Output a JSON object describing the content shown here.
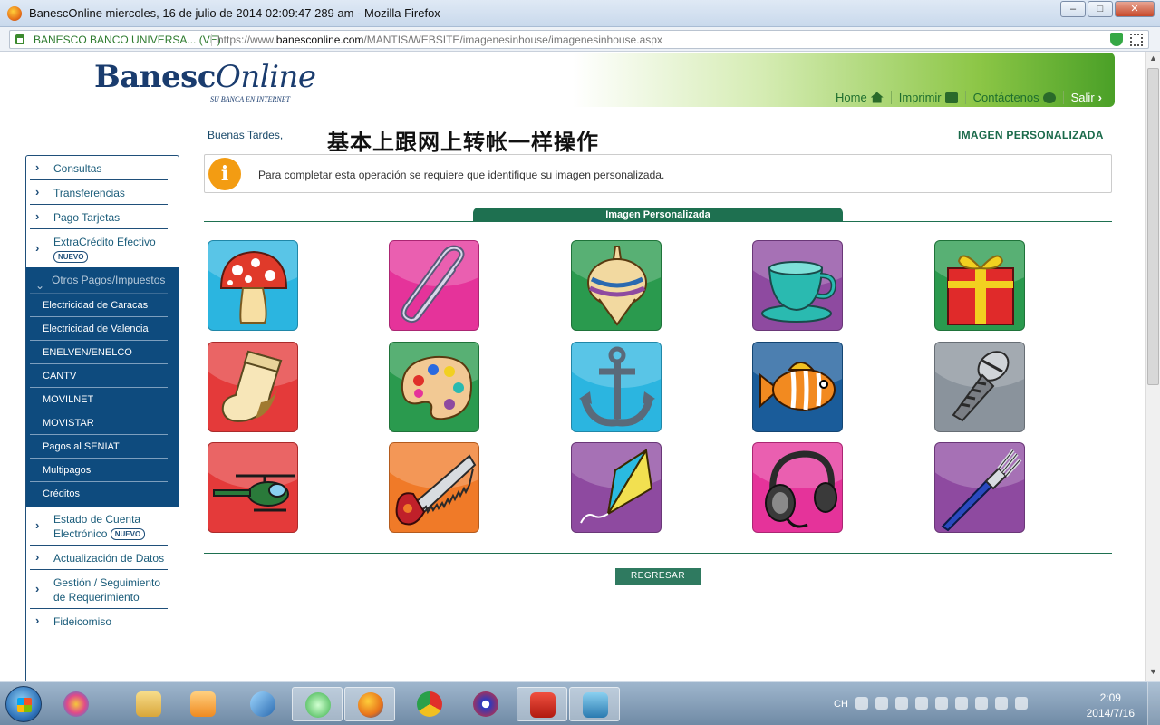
{
  "window": {
    "title": "BanescOnline miercoles, 16 de julio de 2014 02:09:47 289 am - Mozilla Firefox",
    "minimize": "–",
    "maximize": "□",
    "close": "✕"
  },
  "addressbar": {
    "site_identity": "BANESCO BANCO UNIVERSA...  (VE)",
    "url_prefix": "https://www.",
    "url_domain": "banesconline.com",
    "url_path": "/MANTIS/WEBSITE/imagenesinhouse/imagenesinhouse.aspx"
  },
  "header": {
    "logo_main": "Banesc",
    "logo_italic": "Online",
    "logo_tagline": "SU BANCA EN INTERNET",
    "nav": {
      "home": "Home",
      "print": "Imprimir",
      "contact": "Contáctenos",
      "exit": "Salir"
    }
  },
  "sidebar": {
    "items_top": [
      {
        "label": "Consultas"
      },
      {
        "label": "Transferencias"
      },
      {
        "label": "Pago Tarjetas"
      },
      {
        "label": "ExtraCrédito Efectivo",
        "badge": "NUEVO"
      }
    ],
    "group": {
      "label": "Otros Pagos/Impuestos",
      "items": [
        "Electricidad de Caracas",
        "Electricidad de Valencia",
        "ENELVEN/ENELCO",
        "CANTV",
        "MOVILNET",
        "MOVISTAR",
        "Pagos al SENIAT",
        "Multipagos",
        "Créditos"
      ]
    },
    "items_bottom": [
      {
        "label": "Estado de Cuenta Electrónico",
        "badge": "NUEVO"
      },
      {
        "label": "Actualización de Datos"
      },
      {
        "label": "Gestión / Seguimiento de Requerimiento"
      },
      {
        "label": "Fideicomiso"
      }
    ]
  },
  "main": {
    "greeting": "Buenas Tardes,",
    "overlay_note": "基本上跟网上转帐一样操作",
    "heading": "IMAGEN PERSONALIZADA",
    "info_icon": "i",
    "info_text": "Para completar esta operación se requiere que identifique su imagen personalizada.",
    "section_title": "Imagen Personalizada",
    "back_button": "REGRESAR"
  },
  "images": [
    {
      "icon": "mushroom-icon",
      "bg": "#2bb5e0"
    },
    {
      "icon": "paperclip-icon",
      "bg": "#e5339a"
    },
    {
      "icon": "spinning-top-icon",
      "bg": "#2a9a4e"
    },
    {
      "icon": "teacup-icon",
      "bg": "#8e4aa0"
    },
    {
      "icon": "gift-box-icon",
      "bg": "#2a9a4e"
    },
    {
      "icon": "sock-icon",
      "bg": "#e43a3a"
    },
    {
      "icon": "paint-palette-icon",
      "bg": "#2a9a4e"
    },
    {
      "icon": "anchor-icon",
      "bg": "#2bb5e0"
    },
    {
      "icon": "fish-icon",
      "bg": "#1a5c9a"
    },
    {
      "icon": "screw-icon",
      "bg": "#8a939c"
    },
    {
      "icon": "helicopter-icon",
      "bg": "#e43a3a"
    },
    {
      "icon": "saw-icon",
      "bg": "#f07a28"
    },
    {
      "icon": "kite-icon",
      "bg": "#8e4aa0"
    },
    {
      "icon": "headphones-icon",
      "bg": "#e5339a"
    },
    {
      "icon": "fork-icon",
      "bg": "#8e4aa0"
    }
  ],
  "taskbar": {
    "language": "CH",
    "time": "2:09",
    "date": "2014/7/16"
  }
}
